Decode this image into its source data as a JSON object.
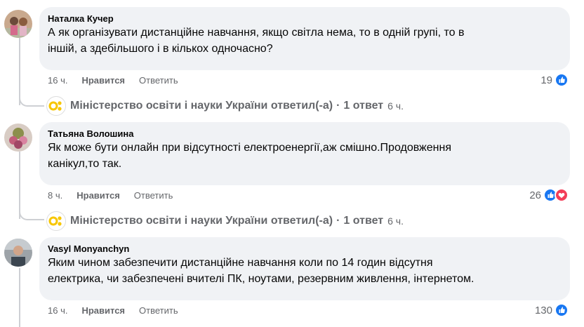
{
  "comments": [
    {
      "author": "Наталка Кучер",
      "lines": [
        "А як організувати дистанційне навчання, якщо світла нема, то в одній групі, то в",
        "іншій, а здебільшого і в кількох одночасно?"
      ],
      "time": "16 ч.",
      "like_label": "Нравится",
      "reply_label": "Ответить",
      "reaction_count": "19",
      "reply_summary": {
        "name": "Міністерство освіти і науки України ответил(-а)",
        "separator": "·",
        "count": "1 ответ",
        "ago": "6 ч."
      }
    },
    {
      "author": "Татьяна Волошина",
      "lines": [
        "Як може бути онлайн при відсутності електроенергії,аж смішно.Продовження",
        "канікул,то так."
      ],
      "time": "8 ч.",
      "like_label": "Нравится",
      "reply_label": "Ответить",
      "reaction_count": "26",
      "reply_summary": {
        "name": "Міністерство освіти і науки України ответил(-а)",
        "separator": "·",
        "count": "1 ответ",
        "ago": "6 ч."
      }
    },
    {
      "author": "Vasyl Monyanchyn",
      "lines": [
        "Яким чином забезпечити дистанційне навчання коли по 14 годин відсутня",
        "електрика, чи забезпечені вчителі ПК, ноутами, резервним живлення, інтернетом."
      ],
      "time": "16 ч.",
      "like_label": "Нравится",
      "reply_label": "Ответить",
      "reaction_count": "130"
    }
  ],
  "colors": {
    "bubble": "#f0f2f5",
    "like_blue": "#1877f2",
    "love_red": "#f33e58",
    "secondary_text": "#65676b",
    "logo_yellow": "#f7c600"
  },
  "icons": [
    "like-reaction-icon",
    "love-reaction-icon",
    "ministry-logo-icon",
    "avatar"
  ]
}
